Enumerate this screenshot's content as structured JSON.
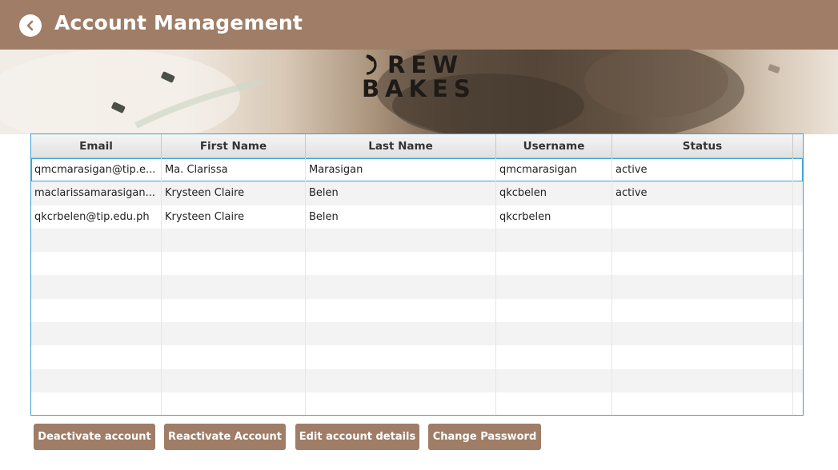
{
  "header": {
    "title": "Account Management",
    "back_icon": "back-arrow-icon",
    "color": "#a07d66"
  },
  "banner": {
    "logo_line1": "REW",
    "logo_line2": "BAKES"
  },
  "table": {
    "columns": [
      "Email",
      "First Name",
      "Last Name",
      "Username",
      "Status"
    ],
    "rows": [
      [
        "qmcmarasigan@tip.e...",
        "Ma. Clarissa",
        "Marasigan",
        "qmcmarasigan",
        "active"
      ],
      [
        "maclarissamarasigan...",
        "Krysteen Claire",
        "Belen",
        "qkcbelen",
        "active"
      ],
      [
        "qkcrbelen@tip.edu.ph",
        "Krysteen Claire",
        "Belen",
        "qkcrbelen",
        ""
      ]
    ],
    "selected_row": 0,
    "accent": "#3ea2d8"
  },
  "actions": {
    "deactivate": "Deactivate account",
    "reactivate": "Reactivate Account",
    "edit": "Edit account details",
    "change_password": "Change Password"
  }
}
